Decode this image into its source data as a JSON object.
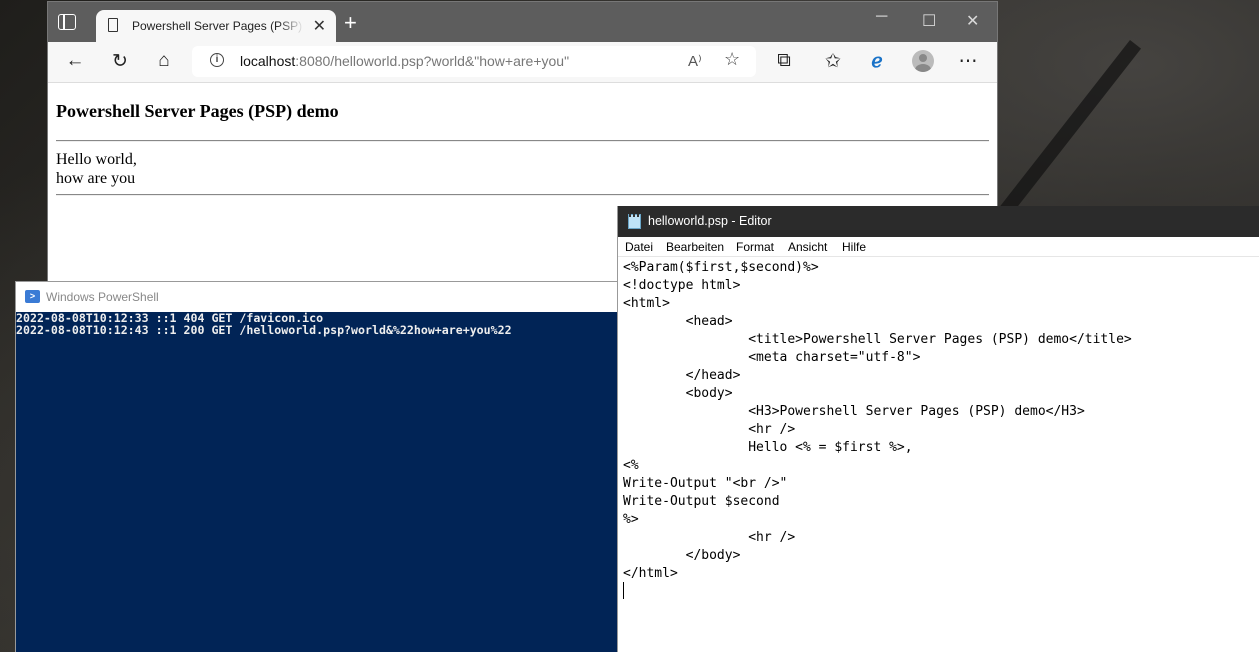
{
  "browser": {
    "tab_title": "Powershell Server Pages (PSP) demo",
    "new_tab_icon": "+",
    "close_tab_icon": "✕",
    "url_host": "localhost",
    "url_rest": ":8080/helloworld.psp?world&\"how+are+you\"",
    "read_aloud_icon": "A⁾",
    "page": {
      "heading": "Powershell Server Pages (PSP) demo",
      "line1": "Hello world,",
      "line2": "how are you"
    }
  },
  "powershell": {
    "title": "Windows PowerShell",
    "console_lines": [
      "2022-08-08T10:12:33 ::1 404 GET /favicon.ico",
      "2022-08-08T10:12:43 ::1 200 GET /helloworld.psp?world&%22how+are+you%22"
    ]
  },
  "editor": {
    "title": "helloworld.psp - Editor",
    "menu": [
      "Datei",
      "Bearbeiten",
      "Format",
      "Ansicht",
      "Hilfe"
    ],
    "lines": [
      "<%Param($first,$second)%>",
      "<!doctype html>",
      "<html>",
      "        <head>",
      "                <title>Powershell Server Pages (PSP) demo</title>",
      "                <meta charset=\"utf-8\">",
      "        </head>",
      "        <body>",
      "                <H3>Powershell Server Pages (PSP) demo</H3>",
      "                <hr />",
      "                Hello <% = $first %>,",
      "<%",
      "Write-Output \"<br />\"",
      "Write-Output $second",
      "%>",
      "                <hr />",
      "        </body>",
      "</html>"
    ]
  }
}
